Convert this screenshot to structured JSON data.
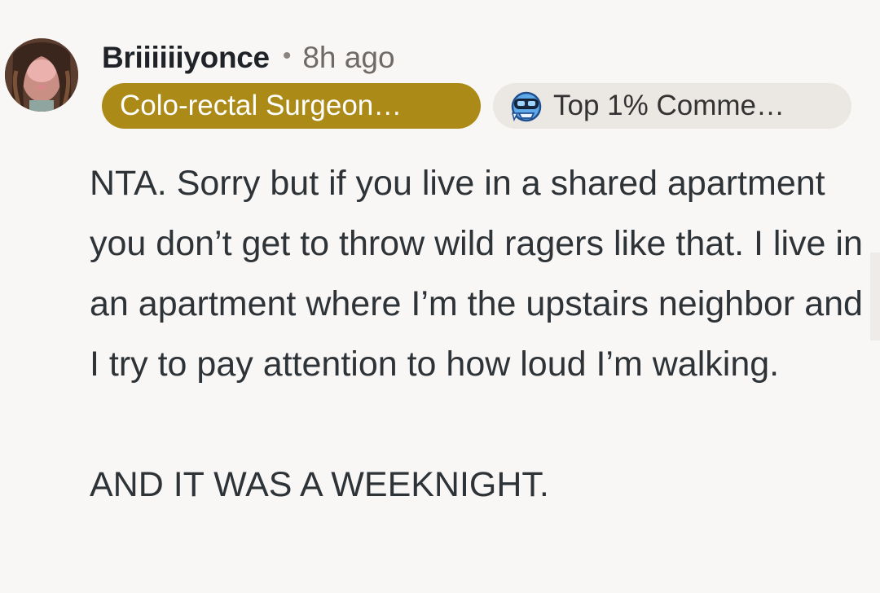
{
  "comment": {
    "author": "Briiiiiiyonce",
    "separator": "•",
    "timestamp": "8h ago",
    "user_flair": "Colo-rectal Surgeon…",
    "achievement_badge": {
      "icon": "commenter-goggles-icon",
      "label": "Top 1% Comme…"
    },
    "body_paragraphs": [
      "NTA. Sorry but if you live in a shared apartment you don’t get to throw wild ragers like that. I live in an apartment where I’m the upstairs neighbor and I try to pay attention to how loud I’m walking.",
      "AND IT WAS A WEEKNIGHT."
    ]
  },
  "colors": {
    "background": "#f9f7f5",
    "flair_background": "#ab8a17",
    "badge_background": "#ebe7e3",
    "text": "#2e3338"
  }
}
